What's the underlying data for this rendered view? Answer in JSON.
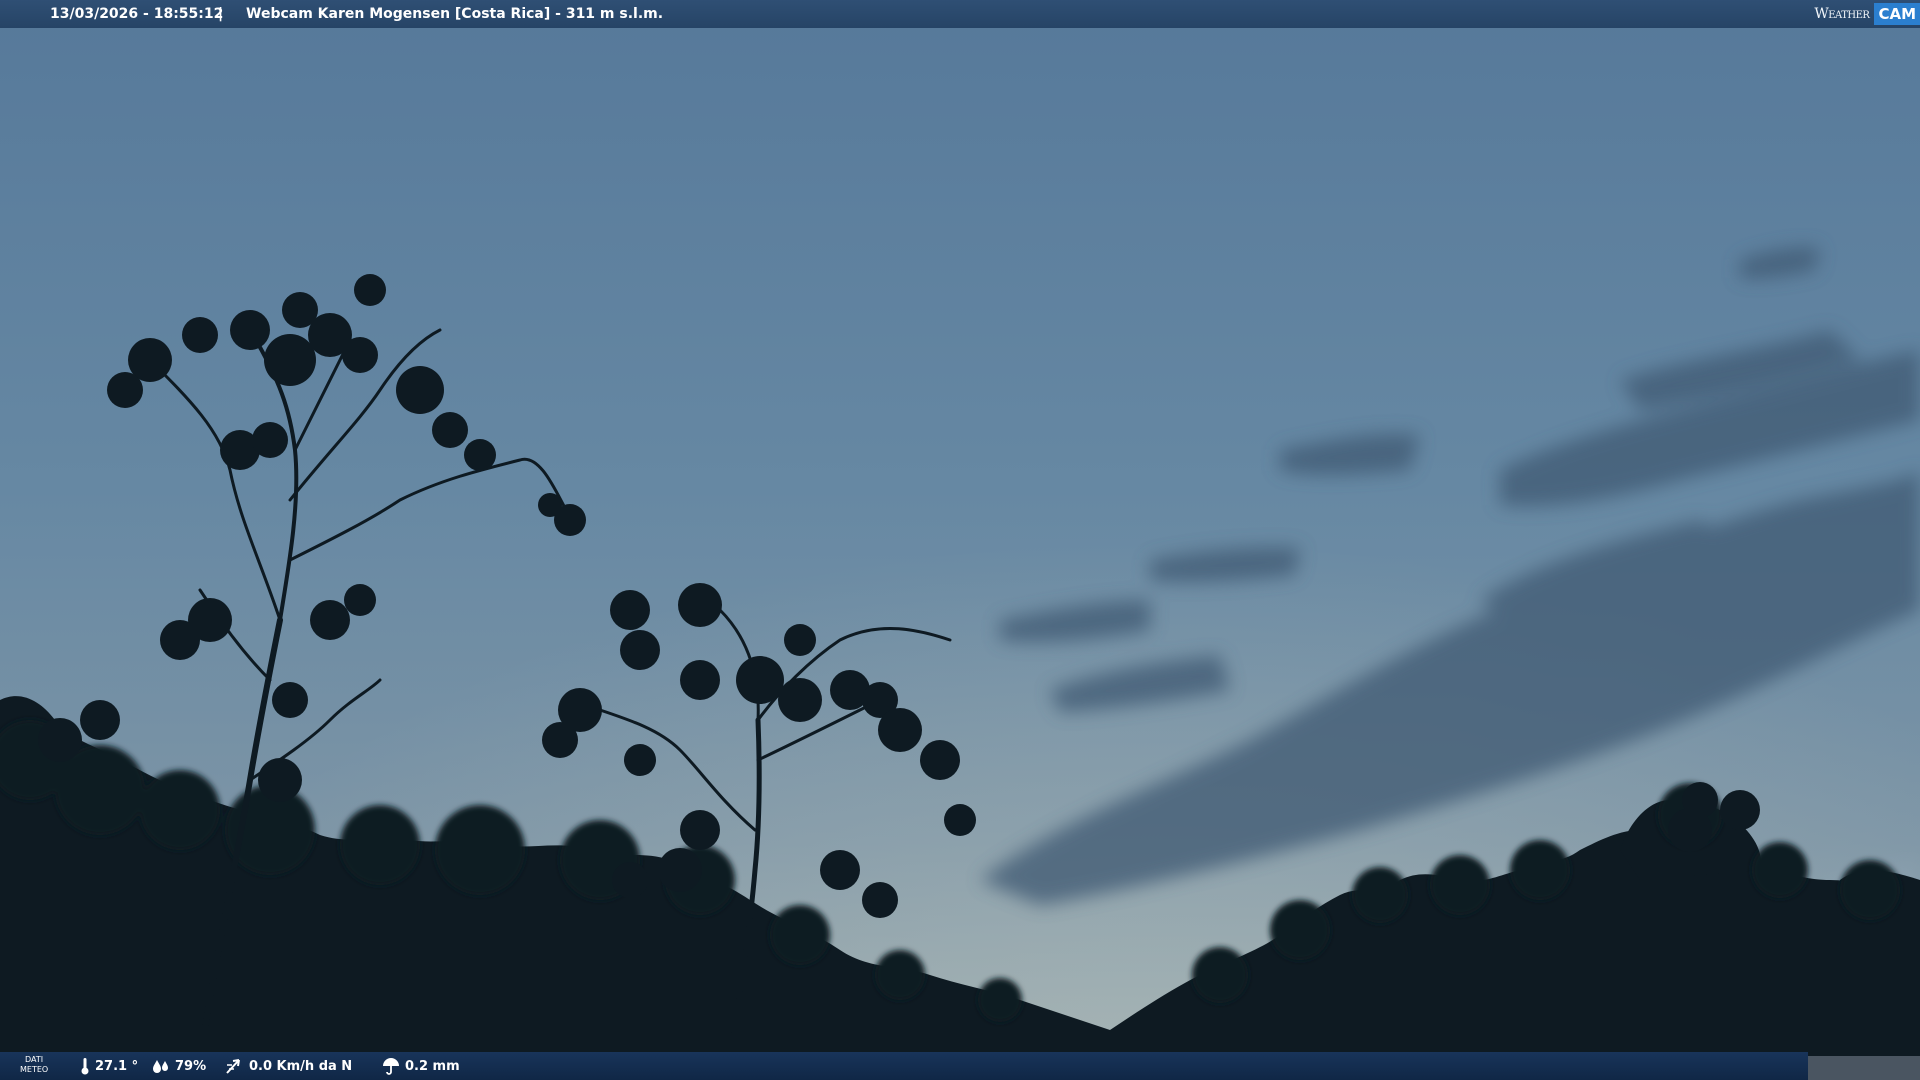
{
  "header": {
    "timestamp": "13/03/2026 - 18:55:12",
    "separator": "|",
    "title": "Webcam Karen Mogensen [Costa Rica] - 311 m s.l.m."
  },
  "brand": {
    "word": "Weather",
    "cam": "CAM"
  },
  "footer": {
    "dati_line1": "DATI",
    "dati_line2": "METEO",
    "temperature": "27.1 °",
    "humidity": "79%",
    "wind": "0.0 Km/h da N",
    "rain": "0.2 mm"
  },
  "colors": {
    "sky_top": "#5a7e9c",
    "sky_bottom": "#8ea2ab",
    "silhouette": "#0e1a22",
    "header_bar": "#2a4a6e",
    "footer_bar": "#14305a"
  }
}
